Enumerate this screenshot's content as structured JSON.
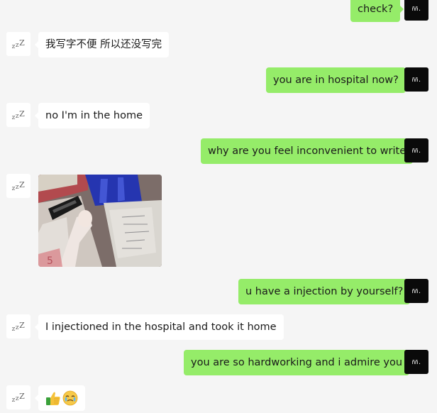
{
  "contact_avatar_text": "zzZ",
  "own_avatar_text": "ññ.",
  "messages": [
    {
      "side": "right",
      "text": "check?"
    },
    {
      "side": "left",
      "text": "我写字不便 所以还没写完"
    },
    {
      "side": "right",
      "text": "you are in hospital now?"
    },
    {
      "side": "left",
      "text": "no I'm in the home"
    },
    {
      "side": "right",
      "text": "why are you feel inconvenient to write"
    },
    {
      "side": "left",
      "type": "image",
      "description": "photo"
    },
    {
      "side": "right",
      "text": "u have a injection by yourself?"
    },
    {
      "side": "left",
      "text": "I injectioned in the hospital and took it home"
    },
    {
      "side": "right",
      "text": "you are so hardworking and i  admire you"
    },
    {
      "side": "left",
      "type": "emoji",
      "emojis": [
        "thumbs-up",
        "crying-face"
      ]
    }
  ],
  "colors": {
    "background": "#f5f5f5",
    "own_bubble": "#95ec69",
    "contact_bubble": "#ffffff",
    "own_avatar": "#0a0a0a"
  }
}
